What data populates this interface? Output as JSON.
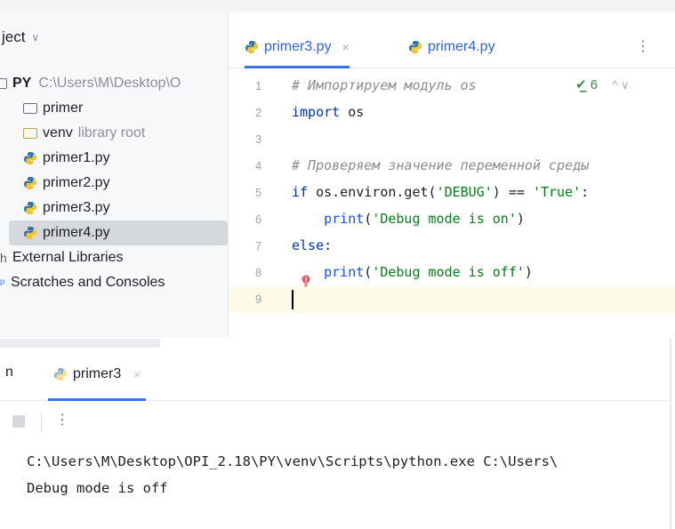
{
  "project_panel": {
    "header": "ject",
    "tree": [
      {
        "label": "PY",
        "path": "C:\\Users\\M\\Desktop\\O",
        "icon": "folder-icon"
      },
      {
        "label": "primer",
        "icon": "folder-icon"
      },
      {
        "label": "venv",
        "suffix": "library root",
        "icon": "venv-folder-icon"
      },
      {
        "label": "primer1.py",
        "icon": "python-file-icon"
      },
      {
        "label": "primer2.py",
        "icon": "python-file-icon"
      },
      {
        "label": "primer3.py",
        "icon": "python-file-icon"
      },
      {
        "label": "primer4.py",
        "icon": "python-file-icon",
        "selected": true
      },
      {
        "label": "External Libraries",
        "icon": "libraries-icon"
      },
      {
        "label": "Scratches and Consoles",
        "icon": "scratches-icon"
      }
    ]
  },
  "editor": {
    "tabs": [
      {
        "label": "primer3.py",
        "active": true,
        "close": "×"
      },
      {
        "label": "primer4.py",
        "active": false
      }
    ],
    "more": "⋮",
    "inspection": {
      "count": "6",
      "arrows": "^ ∨"
    },
    "lines": [
      {
        "num": "1"
      },
      {
        "num": "2"
      },
      {
        "num": "3"
      },
      {
        "num": "4"
      },
      {
        "num": "5"
      },
      {
        "num": "6"
      },
      {
        "num": "7"
      },
      {
        "num": "8"
      },
      {
        "num": "9"
      }
    ],
    "code": {
      "l1": "# Импортируем модуль os",
      "l2_kw": "import",
      "l2_rest": " os",
      "l4": "# Проверяем значение переменной среды",
      "l5_kw": "if",
      "l5_a": " os.environ.get(",
      "l5_s1": "'DEBUG'",
      "l5_b": ") == ",
      "l5_s2": "'True'",
      "l5_c": ":",
      "l6_indent": "    ",
      "l6_fn": "print",
      "l6_a": "(",
      "l6_s": "'Debug mode is on'",
      "l6_b": ")",
      "l7_kw": "else",
      "l7_c": ":",
      "l8_indent": "    ",
      "l8_fn": "print",
      "l8_a": "(",
      "l8_s": "'Debug mode is off'",
      "l8_b": ")"
    }
  },
  "run_panel": {
    "left_tab_fragment": "n",
    "tab_label": "primer3",
    "tab_close": "×",
    "toolbar_more": "⋮",
    "console": [
      "C:\\Users\\M\\Desktop\\OPI_2.18\\PY\\venv\\Scripts\\python.exe C:\\Users\\",
      "Debug mode is off"
    ]
  },
  "colors": {
    "keyword": "#0033b3",
    "string": "#067d17",
    "comment": "#8c8c8c",
    "accent": "#3574f0"
  }
}
